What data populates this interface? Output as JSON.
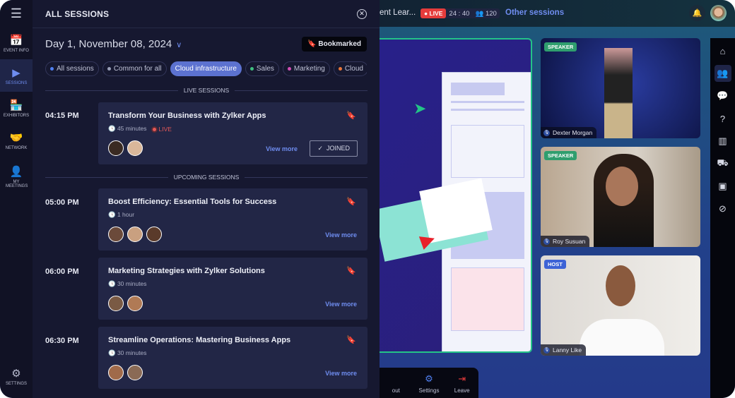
{
  "rail": {
    "items": [
      {
        "label": "EVENT INFO",
        "icon": "calendar-info-icon"
      },
      {
        "label": "SESSIONS",
        "icon": "play-icon"
      },
      {
        "label": "EXHIBITORS",
        "icon": "booth-icon"
      },
      {
        "label": "NETWORK",
        "icon": "handshake-icon"
      },
      {
        "label": "MY MEETINGS",
        "icon": "meetings-icon"
      }
    ],
    "settings": "SETTINGS"
  },
  "panel": {
    "title": "ALL SESSIONS",
    "day": "Day 1, November 08, 2024",
    "bookmarked": "Bookmarked",
    "chips": [
      {
        "label": "All sessions",
        "color": "#4f7ff0"
      },
      {
        "label": "Common for all",
        "color": "#9aa0b8"
      },
      {
        "label": "Cloud infrastructure",
        "color": ""
      },
      {
        "label": "Sales",
        "color": "#3fbf7f"
      },
      {
        "label": "Marketing",
        "color": "#d24fb5"
      },
      {
        "label": "Cloud",
        "color": "#e8763a"
      }
    ],
    "live_heading": "LIVE SESSIONS",
    "upcoming_heading": "UPCOMING SESSIONS",
    "sessions": [
      {
        "time": "04:15 PM",
        "title": "Transform Your Business with Zylker Apps",
        "duration": "45 minutes",
        "live": "LIVE",
        "view": "View more",
        "joined": "JOINED"
      },
      {
        "time": "05:00 PM",
        "title": "Boost Efficiency: Essential Tools for Success",
        "duration": "1 hour",
        "view": "View more"
      },
      {
        "time": "06:00 PM",
        "title": "Marketing Strategies with Zylker Solutions",
        "duration": "30 minutes",
        "view": "View more"
      },
      {
        "time": "06:30 PM",
        "title": "Streamline Operations: Mastering Business Apps",
        "duration": "30 minutes",
        "view": "View more"
      }
    ]
  },
  "top": {
    "session": "ent Lear...",
    "live": "LIVE",
    "timer": "24 : 40",
    "attendees": "120",
    "other": "Other sessions"
  },
  "tiles": [
    {
      "role": "SPEAKER",
      "name": "Dexter Morgan",
      "color": "#2f9e6e"
    },
    {
      "role": "SPEAKER",
      "name": "Roy Susuan",
      "color": "#2f9e6e"
    },
    {
      "role": "HOST",
      "name": "Lanny Like",
      "color": "#3d63d6"
    }
  ],
  "tools": {
    "about": "out",
    "settings": "Settings",
    "leave": "Leave"
  }
}
